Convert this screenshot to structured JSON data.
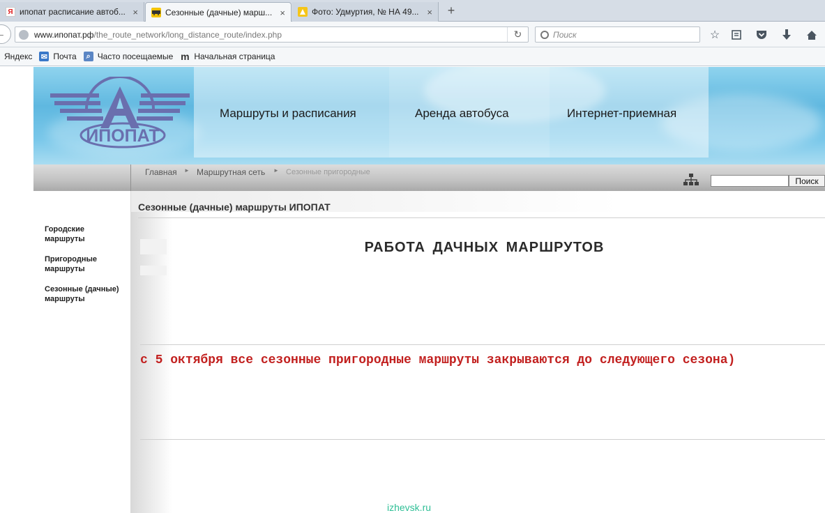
{
  "browser": {
    "tabs": [
      {
        "title": "ипопат расписание автоб...",
        "favicon": "yandex-icon"
      },
      {
        "title": "Сезонные (дачные) марш...",
        "favicon": "bus-icon"
      },
      {
        "title": "Фото: Удмуртия, № НА 49...",
        "favicon": "photo-icon"
      }
    ],
    "new_tab_glyph": "+",
    "close_glyph": "×",
    "url": {
      "host": "www.ипопат.рф",
      "path": "/the_route_network/long_distance_route/index.php"
    },
    "search_placeholder": "Поиск",
    "bookmarks": [
      {
        "label": "Яндекс",
        "icon": "yandex-icon"
      },
      {
        "label": "Почта",
        "icon": "mail-icon"
      },
      {
        "label": "Часто посещаемые",
        "icon": "frequent-icon"
      },
      {
        "label": "Начальная страница",
        "icon": "m-logo-icon"
      }
    ]
  },
  "site": {
    "logo_text": "ИПОПАТ",
    "menu": [
      "Маршруты и расписания",
      "Аренда автобуса",
      "Интернет-приемная"
    ],
    "breadcrumbs": [
      "Главная",
      "Маршрутная сеть",
      "Сезонные пригородные"
    ],
    "search_button": "Поиск",
    "sidebar": [
      "Городские маршруты",
      "Пригородные маршруты",
      "Сезонные (дачные) маршруты"
    ],
    "page_title": "Сезонные (дачные) маршруты ИПОПАТ",
    "headline": "РАБОТА ДАЧНЫХ МАРШРУТОВ",
    "notice": "с 5 октября все сезонные пригородные маршруты закрываются до следующего сезона)",
    "watermark": "izhevsk.ru",
    "colors": {
      "notice": "#c2201f",
      "header_sky": "#5fb8e0",
      "logo": "#6a6fae",
      "watermark": "#2fbf96"
    }
  }
}
